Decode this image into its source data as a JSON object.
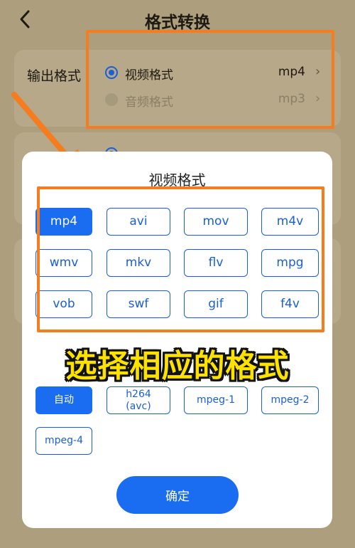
{
  "header": {
    "title": "格式转换"
  },
  "output_format": {
    "label": "输出格式",
    "options": [
      {
        "label": "视频格式",
        "value": "mp4",
        "selected": true
      },
      {
        "label": "音频格式",
        "value": "mp3",
        "selected": false
      }
    ]
  },
  "modal": {
    "title": "视频格式",
    "formats": [
      "mp4",
      "avi",
      "mov",
      "m4v",
      "wmv",
      "mkv",
      "flv",
      "mpg",
      "vob",
      "swf",
      "gif",
      "f4v"
    ],
    "selected_format": "mp4",
    "codecs": [
      "自动",
      "h264\n(avc)",
      "mpeg-1",
      "mpeg-2",
      "mpeg-4"
    ],
    "selected_codec": "自动",
    "confirm_label": "确定"
  },
  "annotation": {
    "caption": "选择相应的格式"
  },
  "colors": {
    "accent": "#1a6cf0",
    "highlight": "#f57c1f",
    "caption": "#fde200"
  },
  "icons": {
    "back": "chevron-left-icon",
    "chevron": "chevron-right-icon"
  }
}
